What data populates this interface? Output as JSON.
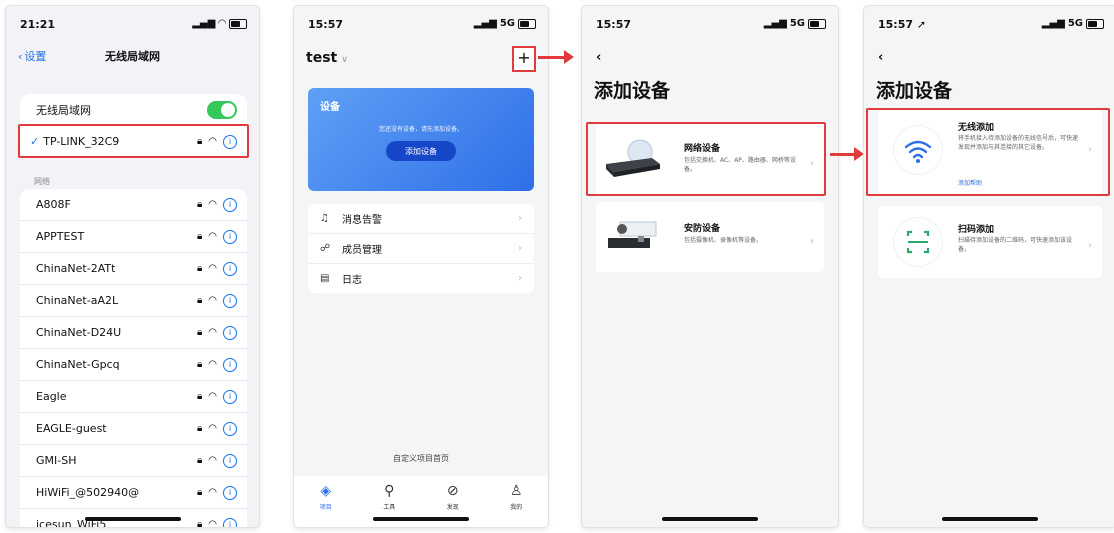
{
  "screen1": {
    "time": "21:21",
    "back_label": "设置",
    "title": "无线局域网",
    "wlan_label": "无线局域网",
    "connected": "TP-LINK_32C9",
    "section_header": "网络",
    "networks": [
      "A808F",
      "APPTEST",
      "ChinaNet-2ATt",
      "ChinaNet-aA2L",
      "ChinaNet-D24U",
      "ChinaNet-Gpcq",
      "Eagle",
      "EAGLE-guest",
      "GMI-SH",
      "HiWiFi_@502940@",
      "icesun_WiFi5"
    ]
  },
  "screen2": {
    "time": "15:57",
    "network_type": "5G",
    "project": "test",
    "plus": "+",
    "card_title": "设备",
    "card_message": "您还没有设备，请先添加设备。",
    "card_button": "添加设备",
    "menu": [
      {
        "icon": "bell-icon",
        "label": "消息告警"
      },
      {
        "icon": "members-icon",
        "label": "成员管理"
      },
      {
        "icon": "log-icon",
        "label": "日志"
      }
    ],
    "footer_link": "自定义项目首页",
    "tabs": [
      {
        "icon": "layers-icon",
        "label": "项目"
      },
      {
        "icon": "wrench-icon",
        "label": "工具"
      },
      {
        "icon": "compass-icon",
        "label": "发现"
      },
      {
        "icon": "user-icon",
        "label": "我的"
      }
    ]
  },
  "screen3": {
    "time": "15:57",
    "network_type": "5G",
    "title": "添加设备",
    "devices": [
      {
        "title": "网络设备",
        "desc": "包括交换机、AC、AP、路由器、网桥等设备。"
      },
      {
        "title": "安防设备",
        "desc": "包括摄像机、录像机等设备。"
      }
    ]
  },
  "screen4": {
    "time": "15:57",
    "network_type": "5G",
    "title": "添加设备",
    "options": [
      {
        "title": "无线添加",
        "desc": "将手机接入待添加设备的无线信号后，可快速发现并添加与其连接的其它设备。",
        "link": "添加帮助"
      },
      {
        "title": "扫码添加",
        "desc": "扫描待添加设备的二维码，可快速添加该设备。"
      }
    ]
  },
  "colors": {
    "accent": "#2e6fe8",
    "highlight": "#e23b3b",
    "ios_blue": "#1a73e8",
    "toggle_on": "#34c759"
  }
}
